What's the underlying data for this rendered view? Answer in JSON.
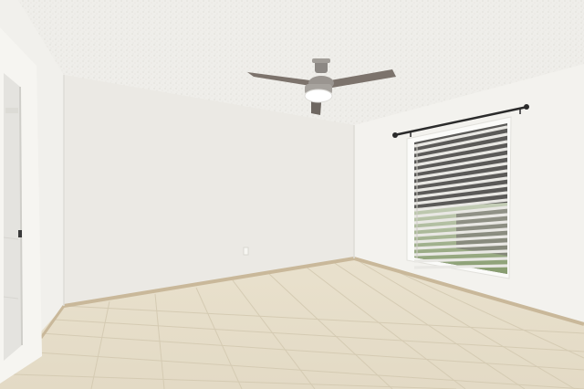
{
  "scene": {
    "type": "photo",
    "subject": "empty room",
    "colors": {
      "ceiling": "#efeeea",
      "left_wall": "#f1f0ec",
      "back_wall": "#ebe9e4",
      "right_wall": "#f3f2ee",
      "floor": "#e7dfcc",
      "baseboard": "#c9b89a",
      "fan_blade": "#7c736c",
      "curtain_rod": "#2b2b2b"
    },
    "icons": [
      "ceiling-fan-icon",
      "window-blinds-icon",
      "curtain-rod-icon",
      "door-frame-icon"
    ]
  }
}
